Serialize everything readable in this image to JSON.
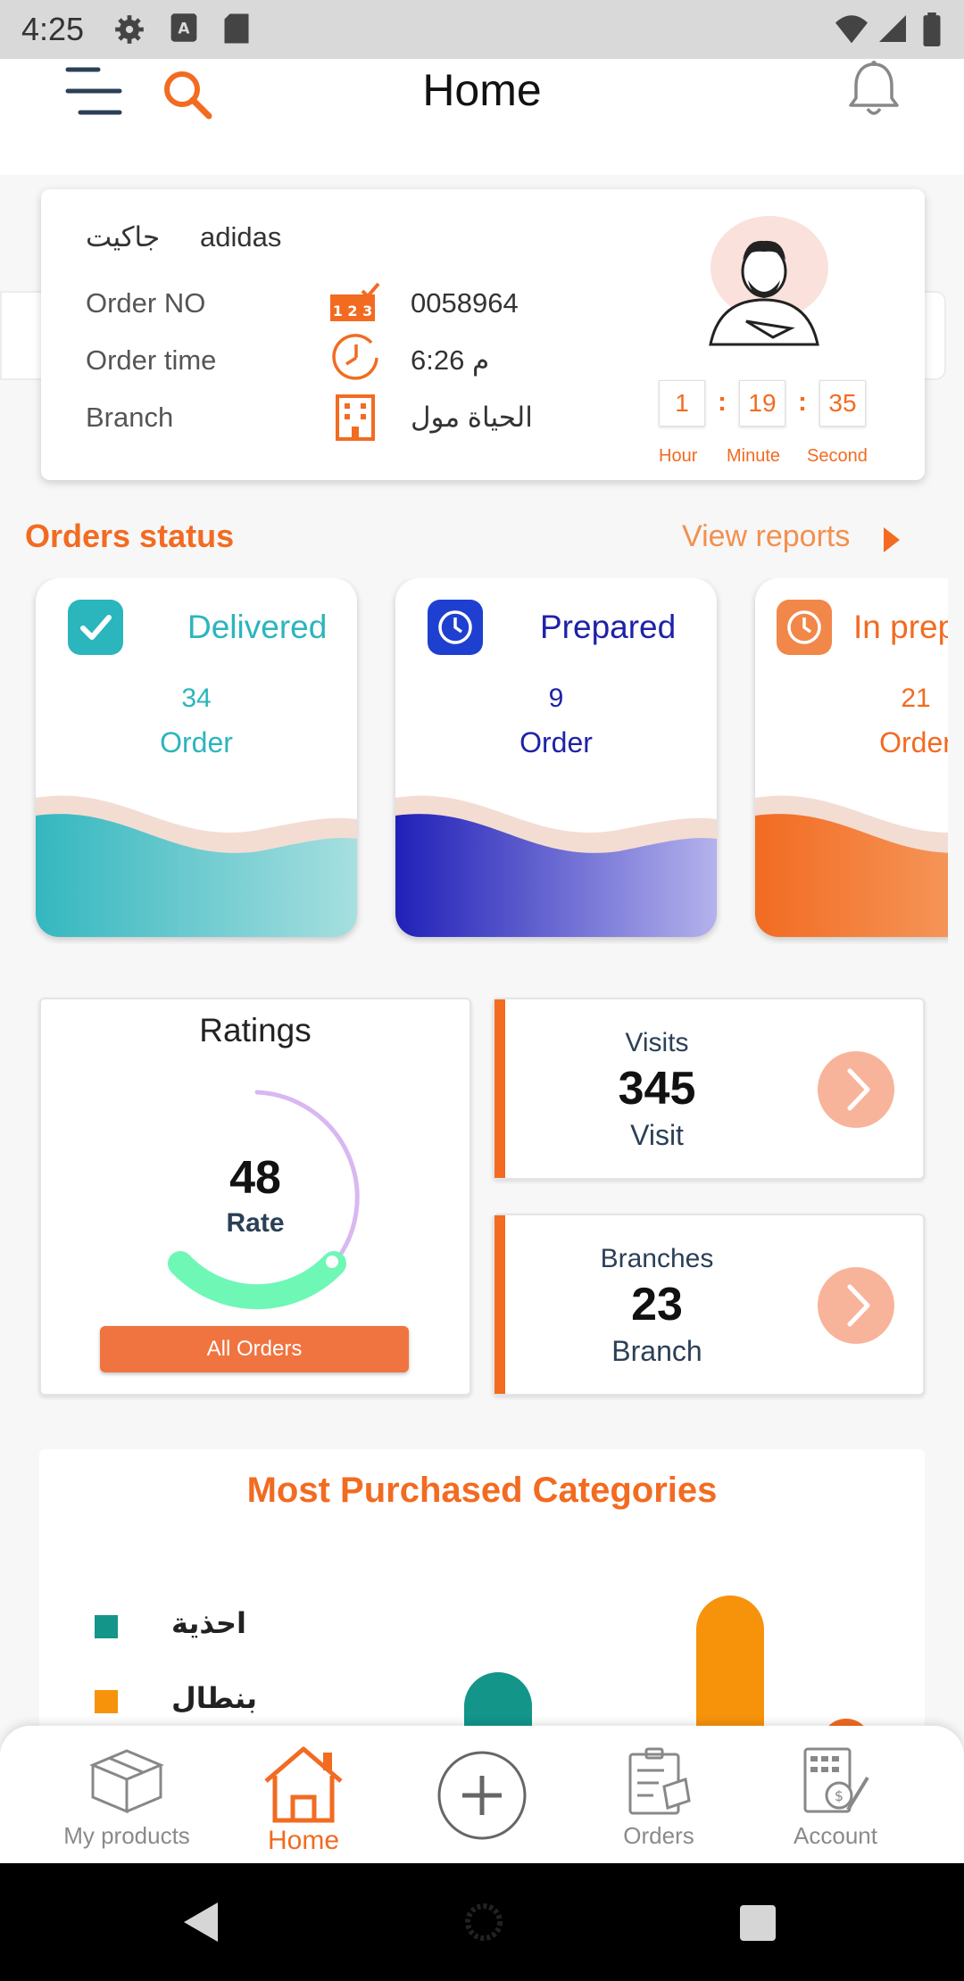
{
  "status_bar": {
    "time": "4:25"
  },
  "header": {
    "title": "Home"
  },
  "order_card": {
    "product_ar": "جاكيت",
    "product_brand": "adidas",
    "rows": [
      {
        "label": "Order NO",
        "value": "0058964"
      },
      {
        "label": "Order time",
        "value": "6:26 م"
      },
      {
        "label": "Branch",
        "value": "الحياة مول"
      }
    ],
    "timer": {
      "hour": "1",
      "minute": "19",
      "second": "35",
      "hour_label": "Hour",
      "minute_label": "Minute",
      "second_label": "Second"
    }
  },
  "orders_status": {
    "title": "Orders status",
    "view_reports": "View reports",
    "cards": [
      {
        "title": "Delivered",
        "count": "34",
        "unit": "Order",
        "color": "#2bb5bd"
      },
      {
        "title": "Prepared",
        "count": "9",
        "unit": "Order",
        "color": "#1e22a8"
      },
      {
        "title": "In preparation",
        "count": "21",
        "unit": "Order",
        "color": "#f26b21"
      }
    ]
  },
  "ratings": {
    "title": "Ratings",
    "value": "48",
    "label": "Rate",
    "button": "All Orders"
  },
  "visits": {
    "top": "Visits",
    "value": "345",
    "unit": "Visit"
  },
  "branches": {
    "top": "Branches",
    "value": "23",
    "unit": "Branch"
  },
  "categories": {
    "title": "Most Purchased Categories",
    "legend": [
      {
        "label": "احذية",
        "color": "#13958a"
      },
      {
        "label": "بنطال",
        "color": "#f7930b"
      }
    ]
  },
  "bottom_nav": {
    "items": [
      {
        "label": "My products"
      },
      {
        "label": "Home"
      },
      {
        "label": ""
      },
      {
        "label": "Orders"
      },
      {
        "label": "Account"
      }
    ]
  },
  "colors": {
    "accent": "#f26b21",
    "teal": "#2bb5bd",
    "indigo": "#1e22a8"
  }
}
